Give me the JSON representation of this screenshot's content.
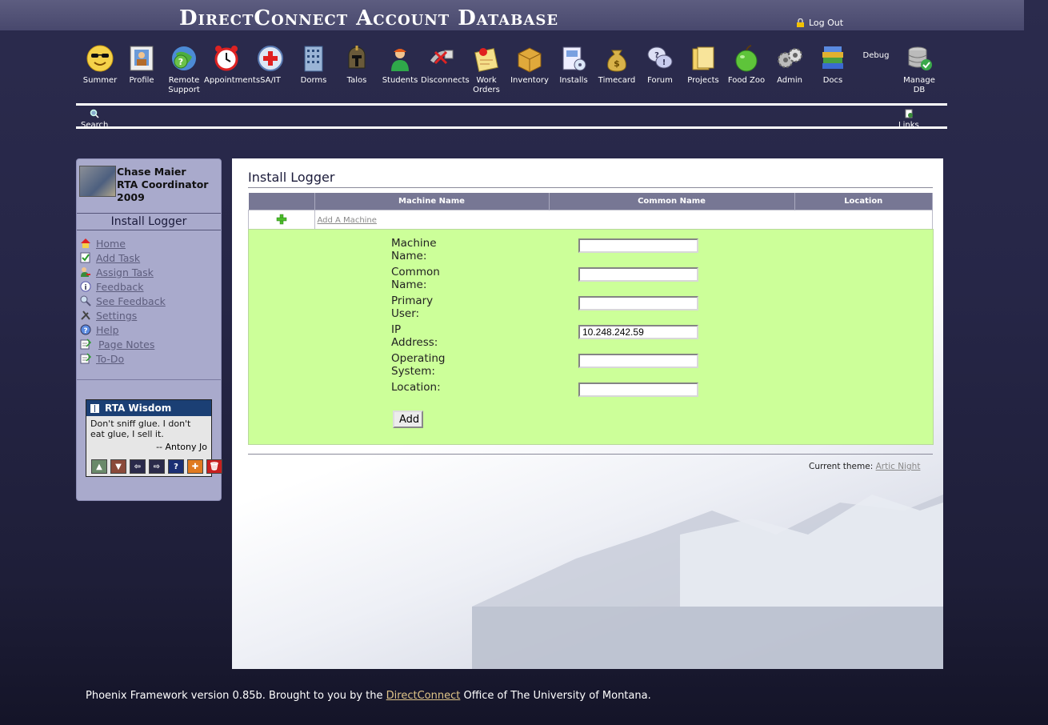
{
  "header": {
    "title": "DirectConnect Account Database",
    "logout_label": "Log Out"
  },
  "nav": [
    {
      "label": "Summer",
      "icon": "sunglasses-smiley-icon"
    },
    {
      "label": "Profile",
      "icon": "profile-card-icon"
    },
    {
      "label": "Remote Support",
      "icon": "remote-support-icon"
    },
    {
      "label": "Appointments",
      "icon": "alarm-clock-icon"
    },
    {
      "label": "SA/IT",
      "icon": "red-cross-icon"
    },
    {
      "label": "Dorms",
      "icon": "building-icon"
    },
    {
      "label": "Talos",
      "icon": "helmet-icon"
    },
    {
      "label": "Students",
      "icon": "student-icon"
    },
    {
      "label": "Disconnects",
      "icon": "disconnect-icon"
    },
    {
      "label": "Work Orders",
      "icon": "pinned-note-icon"
    },
    {
      "label": "Inventory",
      "icon": "box-icon"
    },
    {
      "label": "Installs",
      "icon": "install-icon"
    },
    {
      "label": "Timecard",
      "icon": "money-bag-icon"
    },
    {
      "label": "Forum",
      "icon": "speech-bubbles-icon"
    },
    {
      "label": "Projects",
      "icon": "folders-icon"
    },
    {
      "label": "Food Zoo",
      "icon": "apple-icon"
    },
    {
      "label": "Admin",
      "icon": "gears-icon"
    },
    {
      "label": "Docs",
      "icon": "books-icon"
    },
    {
      "label": "Debug",
      "icon": ""
    },
    {
      "label": "Manage DB",
      "icon": "database-check-icon"
    }
  ],
  "toolbar": {
    "search_label": "Search",
    "links_label": "Links"
  },
  "sidebar": {
    "user_name": "Chase Maier",
    "user_role": "RTA Coordinator",
    "user_year": "2009",
    "section_title": "Install Logger",
    "links": [
      {
        "label": "Home",
        "icon": "home-icon"
      },
      {
        "label": "Add Task",
        "icon": "checkbox-icon"
      },
      {
        "label": "Assign Task",
        "icon": "assign-icon"
      },
      {
        "label": "Feedback",
        "icon": "info-icon"
      },
      {
        "label": "See Feedback",
        "icon": "magnifier-icon"
      },
      {
        "label": "Settings",
        "icon": "tools-icon"
      },
      {
        "label": "Help",
        "icon": "help-icon"
      },
      {
        "label": "Page Notes",
        "icon": "notepad-icon"
      },
      {
        "label": "To-Do",
        "icon": "notepad-icon"
      }
    ],
    "wisdom": {
      "title": "RTA Wisdom",
      "quote": "Don't sniff glue. I don't eat glue, I sell it.",
      "author": "-- Antony Jo"
    }
  },
  "main": {
    "title": "Install Logger",
    "table": {
      "columns": [
        "",
        "Machine Name",
        "Common Name",
        "Location"
      ],
      "add_link": "Add A Machine"
    },
    "form": {
      "fields": [
        {
          "label": "Machine Name:",
          "value": ""
        },
        {
          "label": "Common Name:",
          "value": ""
        },
        {
          "label": "Primary User:",
          "value": ""
        },
        {
          "label": "IP Address:",
          "value": "10.248.242.59"
        },
        {
          "label": "Operating System:",
          "value": ""
        },
        {
          "label": "Location:",
          "value": ""
        }
      ],
      "submit_label": "Add"
    },
    "theme_label": "Current theme:",
    "theme_name": "Artic Night"
  },
  "footer": {
    "prefix": "Phoenix Framework version 0.85b. Brought to you by the ",
    "link": "DirectConnect",
    "suffix": " Office of The University of Montana."
  },
  "colors": {
    "background": "#262647",
    "sidebar": "#a9aacc",
    "table_header": "#777794",
    "form_bg": "#ccff99",
    "wisdom_header": "#1b3f74",
    "footer_link": "#e0c589"
  }
}
